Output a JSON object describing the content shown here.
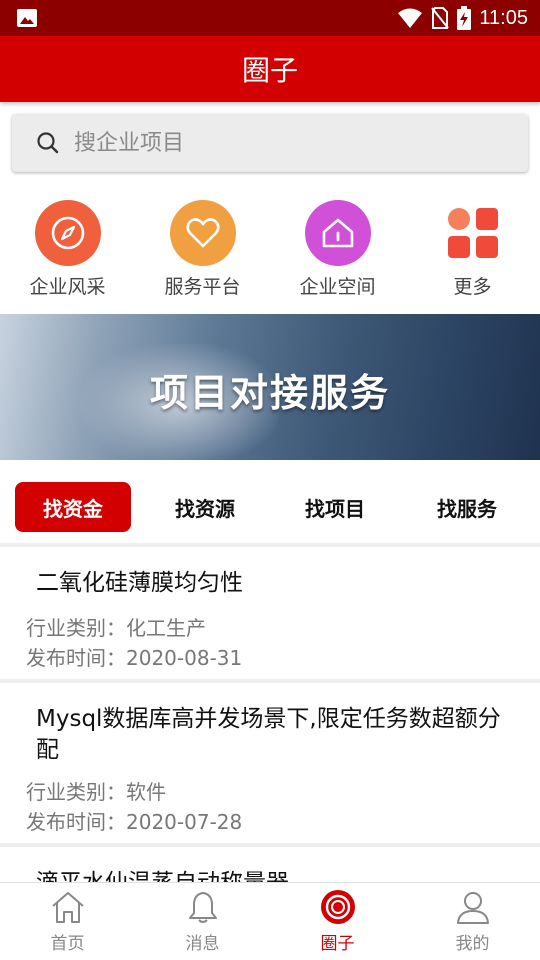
{
  "status_bar": {
    "time": "11:05"
  },
  "header": {
    "title": "圈子"
  },
  "search": {
    "placeholder": "搜企业项目"
  },
  "quick_nav": [
    {
      "label": "企业风采",
      "icon": "compass-icon",
      "color": "#f0603c"
    },
    {
      "label": "服务平台",
      "icon": "heart-icon",
      "color": "#f0a040"
    },
    {
      "label": "企业空间",
      "icon": "home-icon",
      "color": "#d050d8"
    },
    {
      "label": "更多",
      "icon": "grid-icon",
      "color": "#f04a3a"
    }
  ],
  "banner": {
    "text": "项目对接服务"
  },
  "tabs": [
    {
      "label": "找资金",
      "active": true
    },
    {
      "label": "找资源",
      "active": false
    },
    {
      "label": "找项目",
      "active": false
    },
    {
      "label": "找服务",
      "active": false
    }
  ],
  "items": [
    {
      "title": "二氧化硅薄膜均匀性",
      "category": "行业类别：化工生产",
      "date": "发布时间：2020-08-31"
    },
    {
      "title": "Mysql数据库高并发场景下,限定任务数超额分配",
      "category": "行业类别：软件",
      "date": "发布时间：2020-07-28"
    },
    {
      "title": "滴平水仙温蒸自动称量器"
    }
  ],
  "bottom_nav": [
    {
      "label": "首页",
      "icon": "home-outline-icon",
      "active": false
    },
    {
      "label": "消息",
      "icon": "bell-icon",
      "active": false
    },
    {
      "label": "圈子",
      "icon": "circle-icon",
      "active": true
    },
    {
      "label": "我的",
      "icon": "person-icon",
      "active": false
    }
  ],
  "colors": {
    "primary": "#d20000",
    "status_bar": "#8c0000"
  }
}
